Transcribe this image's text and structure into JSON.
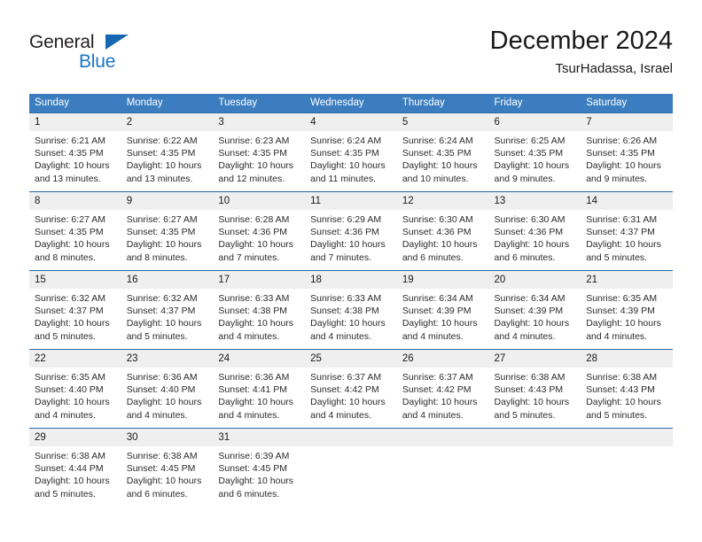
{
  "brand": {
    "name_part1": "General",
    "name_part2": "Blue",
    "logo_icon": "triangle-logo-icon"
  },
  "header": {
    "title": "December 2024",
    "subtitle": "TsurHadassa, Israel"
  },
  "colors": {
    "header_blue": "#3b7dbf",
    "rule_blue": "#2a6ba8",
    "daynum_bg": "#efefef",
    "brand_blue": "#1877c9",
    "text": "#1a1a1a"
  },
  "weekdays": [
    "Sunday",
    "Monday",
    "Tuesday",
    "Wednesday",
    "Thursday",
    "Friday",
    "Saturday"
  ],
  "weeks": [
    [
      {
        "day": "1",
        "sunrise": "Sunrise: 6:21 AM",
        "sunset": "Sunset: 4:35 PM",
        "daylight1": "Daylight: 10 hours",
        "daylight2": "and 13 minutes."
      },
      {
        "day": "2",
        "sunrise": "Sunrise: 6:22 AM",
        "sunset": "Sunset: 4:35 PM",
        "daylight1": "Daylight: 10 hours",
        "daylight2": "and 13 minutes."
      },
      {
        "day": "3",
        "sunrise": "Sunrise: 6:23 AM",
        "sunset": "Sunset: 4:35 PM",
        "daylight1": "Daylight: 10 hours",
        "daylight2": "and 12 minutes."
      },
      {
        "day": "4",
        "sunrise": "Sunrise: 6:24 AM",
        "sunset": "Sunset: 4:35 PM",
        "daylight1": "Daylight: 10 hours",
        "daylight2": "and 11 minutes."
      },
      {
        "day": "5",
        "sunrise": "Sunrise: 6:24 AM",
        "sunset": "Sunset: 4:35 PM",
        "daylight1": "Daylight: 10 hours",
        "daylight2": "and 10 minutes."
      },
      {
        "day": "6",
        "sunrise": "Sunrise: 6:25 AM",
        "sunset": "Sunset: 4:35 PM",
        "daylight1": "Daylight: 10 hours",
        "daylight2": "and 9 minutes."
      },
      {
        "day": "7",
        "sunrise": "Sunrise: 6:26 AM",
        "sunset": "Sunset: 4:35 PM",
        "daylight1": "Daylight: 10 hours",
        "daylight2": "and 9 minutes."
      }
    ],
    [
      {
        "day": "8",
        "sunrise": "Sunrise: 6:27 AM",
        "sunset": "Sunset: 4:35 PM",
        "daylight1": "Daylight: 10 hours",
        "daylight2": "and 8 minutes."
      },
      {
        "day": "9",
        "sunrise": "Sunrise: 6:27 AM",
        "sunset": "Sunset: 4:35 PM",
        "daylight1": "Daylight: 10 hours",
        "daylight2": "and 8 minutes."
      },
      {
        "day": "10",
        "sunrise": "Sunrise: 6:28 AM",
        "sunset": "Sunset: 4:36 PM",
        "daylight1": "Daylight: 10 hours",
        "daylight2": "and 7 minutes."
      },
      {
        "day": "11",
        "sunrise": "Sunrise: 6:29 AM",
        "sunset": "Sunset: 4:36 PM",
        "daylight1": "Daylight: 10 hours",
        "daylight2": "and 7 minutes."
      },
      {
        "day": "12",
        "sunrise": "Sunrise: 6:30 AM",
        "sunset": "Sunset: 4:36 PM",
        "daylight1": "Daylight: 10 hours",
        "daylight2": "and 6 minutes."
      },
      {
        "day": "13",
        "sunrise": "Sunrise: 6:30 AM",
        "sunset": "Sunset: 4:36 PM",
        "daylight1": "Daylight: 10 hours",
        "daylight2": "and 6 minutes."
      },
      {
        "day": "14",
        "sunrise": "Sunrise: 6:31 AM",
        "sunset": "Sunset: 4:37 PM",
        "daylight1": "Daylight: 10 hours",
        "daylight2": "and 5 minutes."
      }
    ],
    [
      {
        "day": "15",
        "sunrise": "Sunrise: 6:32 AM",
        "sunset": "Sunset: 4:37 PM",
        "daylight1": "Daylight: 10 hours",
        "daylight2": "and 5 minutes."
      },
      {
        "day": "16",
        "sunrise": "Sunrise: 6:32 AM",
        "sunset": "Sunset: 4:37 PM",
        "daylight1": "Daylight: 10 hours",
        "daylight2": "and 5 minutes."
      },
      {
        "day": "17",
        "sunrise": "Sunrise: 6:33 AM",
        "sunset": "Sunset: 4:38 PM",
        "daylight1": "Daylight: 10 hours",
        "daylight2": "and 4 minutes."
      },
      {
        "day": "18",
        "sunrise": "Sunrise: 6:33 AM",
        "sunset": "Sunset: 4:38 PM",
        "daylight1": "Daylight: 10 hours",
        "daylight2": "and 4 minutes."
      },
      {
        "day": "19",
        "sunrise": "Sunrise: 6:34 AM",
        "sunset": "Sunset: 4:39 PM",
        "daylight1": "Daylight: 10 hours",
        "daylight2": "and 4 minutes."
      },
      {
        "day": "20",
        "sunrise": "Sunrise: 6:34 AM",
        "sunset": "Sunset: 4:39 PM",
        "daylight1": "Daylight: 10 hours",
        "daylight2": "and 4 minutes."
      },
      {
        "day": "21",
        "sunrise": "Sunrise: 6:35 AM",
        "sunset": "Sunset: 4:39 PM",
        "daylight1": "Daylight: 10 hours",
        "daylight2": "and 4 minutes."
      }
    ],
    [
      {
        "day": "22",
        "sunrise": "Sunrise: 6:35 AM",
        "sunset": "Sunset: 4:40 PM",
        "daylight1": "Daylight: 10 hours",
        "daylight2": "and 4 minutes."
      },
      {
        "day": "23",
        "sunrise": "Sunrise: 6:36 AM",
        "sunset": "Sunset: 4:40 PM",
        "daylight1": "Daylight: 10 hours",
        "daylight2": "and 4 minutes."
      },
      {
        "day": "24",
        "sunrise": "Sunrise: 6:36 AM",
        "sunset": "Sunset: 4:41 PM",
        "daylight1": "Daylight: 10 hours",
        "daylight2": "and 4 minutes."
      },
      {
        "day": "25",
        "sunrise": "Sunrise: 6:37 AM",
        "sunset": "Sunset: 4:42 PM",
        "daylight1": "Daylight: 10 hours",
        "daylight2": "and 4 minutes."
      },
      {
        "day": "26",
        "sunrise": "Sunrise: 6:37 AM",
        "sunset": "Sunset: 4:42 PM",
        "daylight1": "Daylight: 10 hours",
        "daylight2": "and 4 minutes."
      },
      {
        "day": "27",
        "sunrise": "Sunrise: 6:38 AM",
        "sunset": "Sunset: 4:43 PM",
        "daylight1": "Daylight: 10 hours",
        "daylight2": "and 5 minutes."
      },
      {
        "day": "28",
        "sunrise": "Sunrise: 6:38 AM",
        "sunset": "Sunset: 4:43 PM",
        "daylight1": "Daylight: 10 hours",
        "daylight2": "and 5 minutes."
      }
    ],
    [
      {
        "day": "29",
        "sunrise": "Sunrise: 6:38 AM",
        "sunset": "Sunset: 4:44 PM",
        "daylight1": "Daylight: 10 hours",
        "daylight2": "and 5 minutes."
      },
      {
        "day": "30",
        "sunrise": "Sunrise: 6:38 AM",
        "sunset": "Sunset: 4:45 PM",
        "daylight1": "Daylight: 10 hours",
        "daylight2": "and 6 minutes."
      },
      {
        "day": "31",
        "sunrise": "Sunrise: 6:39 AM",
        "sunset": "Sunset: 4:45 PM",
        "daylight1": "Daylight: 10 hours",
        "daylight2": "and 6 minutes."
      },
      {
        "day": "",
        "sunrise": "",
        "sunset": "",
        "daylight1": "",
        "daylight2": ""
      },
      {
        "day": "",
        "sunrise": "",
        "sunset": "",
        "daylight1": "",
        "daylight2": ""
      },
      {
        "day": "",
        "sunrise": "",
        "sunset": "",
        "daylight1": "",
        "daylight2": ""
      },
      {
        "day": "",
        "sunrise": "",
        "sunset": "",
        "daylight1": "",
        "daylight2": ""
      }
    ]
  ]
}
